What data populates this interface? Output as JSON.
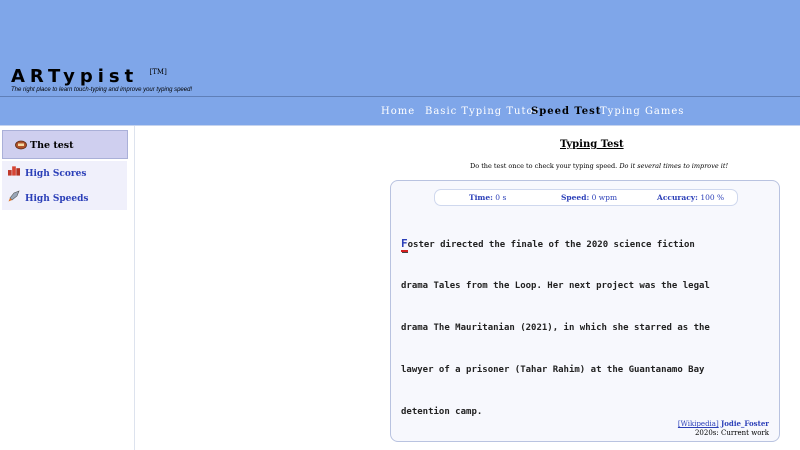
{
  "header": {
    "logo": "ARTypist",
    "trademark": "[TM]",
    "tagline": "The right place to learn touch-typing and improve your typing speed!"
  },
  "nav": {
    "items": [
      {
        "label": "Home"
      },
      {
        "label": "Basic Typing Tutor"
      },
      {
        "label": "Speed Test"
      },
      {
        "label": "Typing Games"
      }
    ],
    "active": "Speed Test"
  },
  "sidebar": {
    "items": [
      {
        "label": "The test",
        "icon": "keyboard-icon"
      },
      {
        "label": "High Scores",
        "icon": "podium-icon"
      },
      {
        "label": "High Speeds",
        "icon": "rocket-icon"
      }
    ]
  },
  "main": {
    "title": "Typing Test",
    "intro_plain": "Do the test once to check your typing speed.",
    "intro_emph": "Do it several times to improve it!",
    "stats": {
      "time_label": "Time:",
      "time_value": "0 s",
      "speed_label": "Speed:",
      "speed_value": "0 wpm",
      "accuracy_label": "Accuracy:",
      "accuracy_value": "100 %"
    },
    "text": {
      "current_char": "F",
      "line1_rest": "oster directed the finale of the 2020 science fiction",
      "line2": "drama Tales from the Loop. Her next project was the legal",
      "line3": "drama The Mauritanian (2021), in which she starred as the",
      "line4": "lawyer of a prisoner (Tahar Rahim) at the Guantanamo Bay",
      "line5": "detention camp."
    },
    "source": {
      "site": "[Wikipedia]",
      "article": "Jodie_Foster",
      "section": "2020s: Current work"
    }
  },
  "colors": {
    "header_bg": "#7fa6e9",
    "link": "#2b3fb8",
    "cursor_underline": "#d22020"
  }
}
